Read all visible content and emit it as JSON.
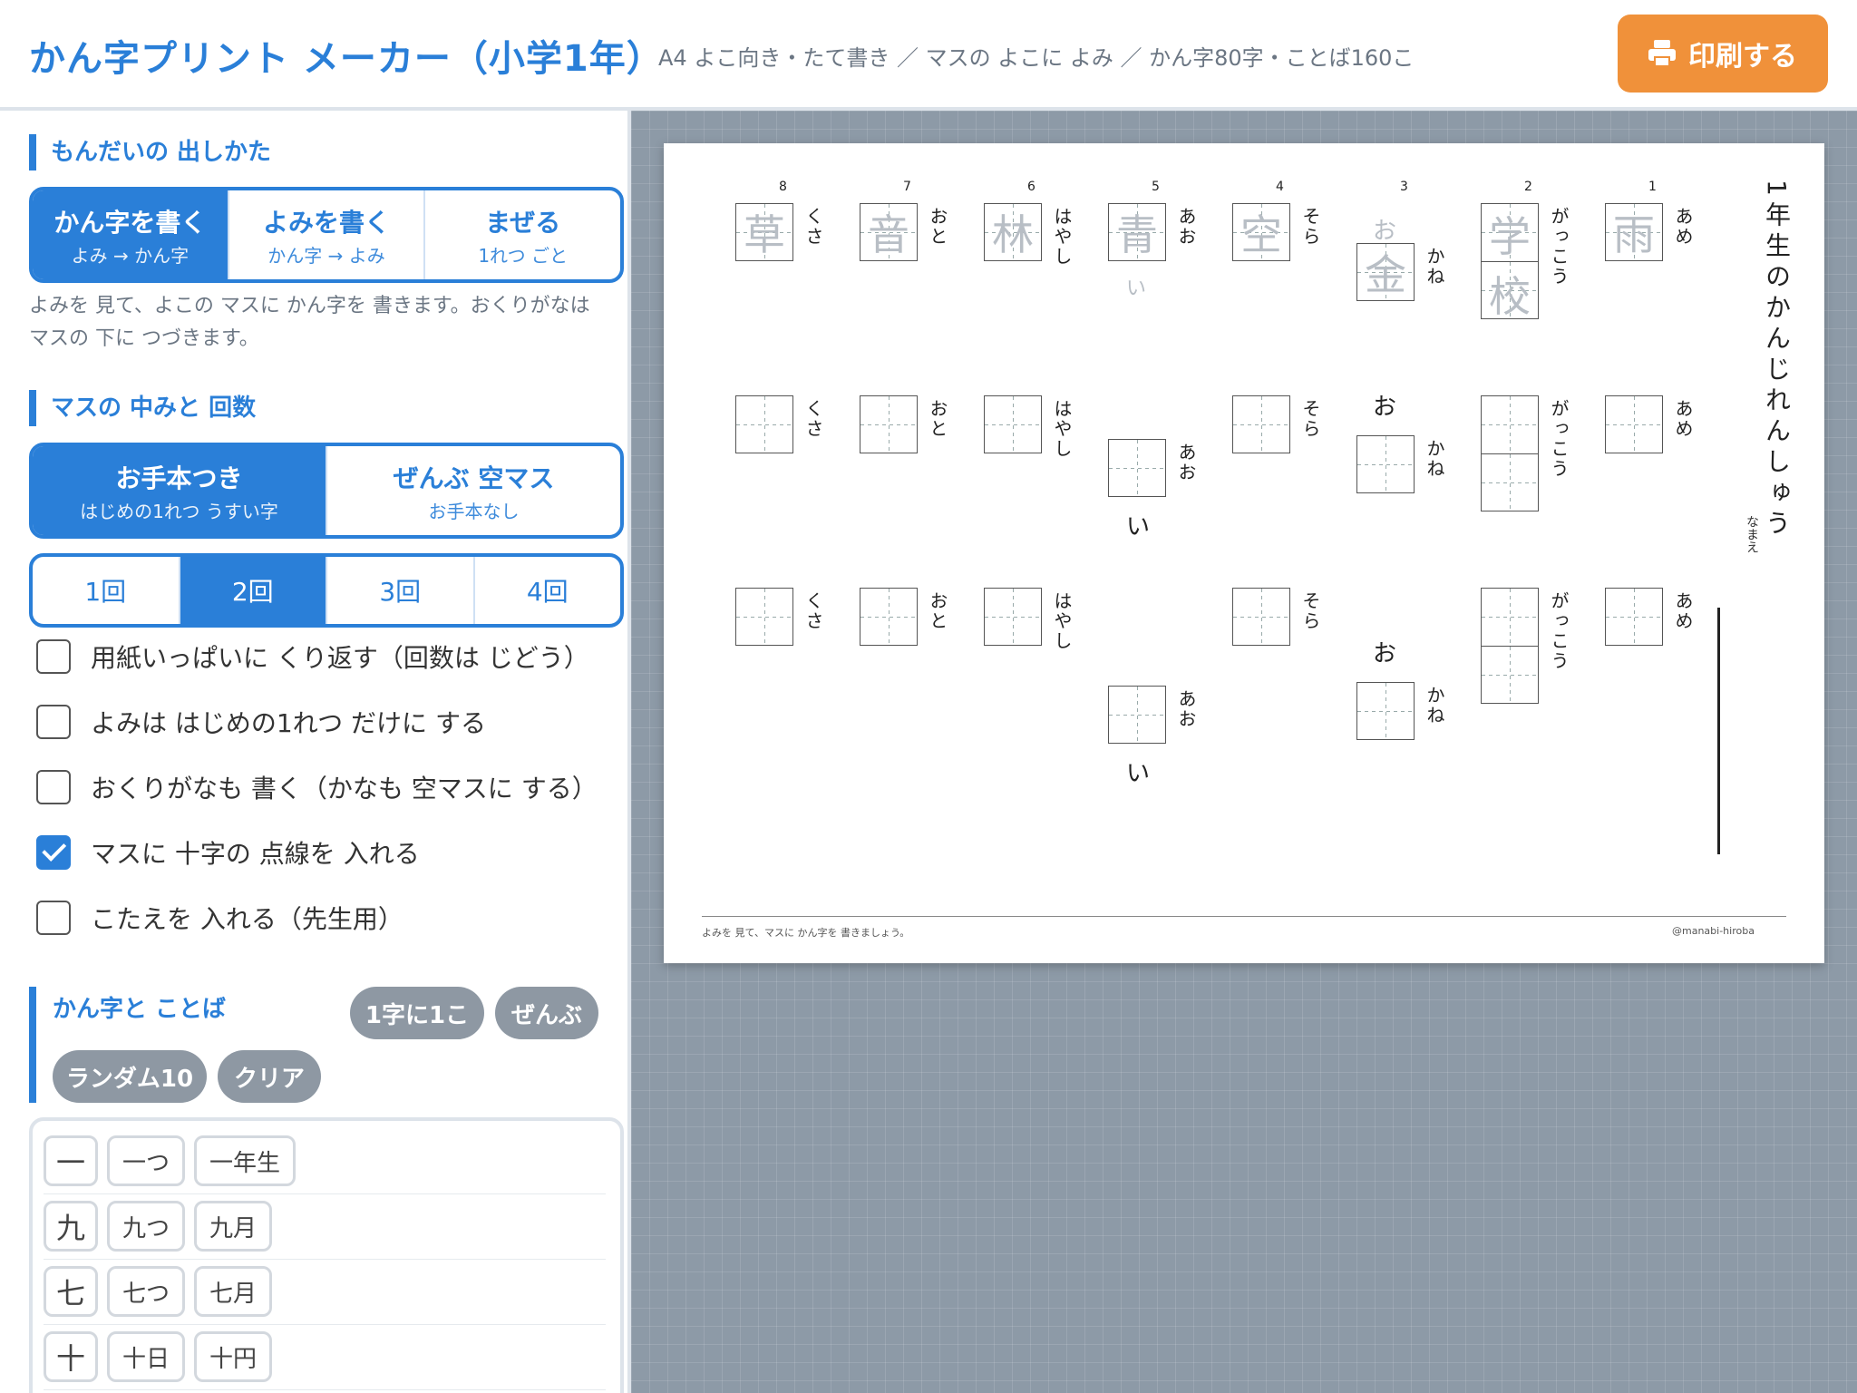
{
  "header": {
    "title": "かん字プリント メーカー（小学1年）",
    "subtitle": "A4 よこ向き・たて書き ／ マスの よこに よみ ／ かん字80字・ことば160こ",
    "print_label": "印刷する"
  },
  "sidebar": {
    "mode_heading": "もんだいの 出しかた",
    "mode_options": [
      {
        "label": "かん字を書く",
        "sub": "よみ → かん字"
      },
      {
        "label": "よみを書く",
        "sub": "かん字 → よみ"
      },
      {
        "label": "まぜる",
        "sub": "1れつ ごと"
      }
    ],
    "mode_desc": "よみを 見て、よこの マスに かん字を 書きます。おくりがなは マスの 下に つづきます。",
    "box_heading": "マスの 中みと 回数",
    "box_options": [
      {
        "label": "お手本つき",
        "sub": "はじめの1れつ うすい字"
      },
      {
        "label": "ぜんぶ 空マス",
        "sub": "お手本なし"
      }
    ],
    "count_options": [
      "1回",
      "2回",
      "3回",
      "4回"
    ],
    "checkboxes": [
      {
        "label": "用紙いっぱいに くり返す（回数は じどう）",
        "checked": false
      },
      {
        "label": "よみは はじめの1れつ だけに する",
        "checked": false
      },
      {
        "label": "おくりがなも 書く（かなも 空マスに する）",
        "checked": false
      },
      {
        "label": "マスに 十字の 点線を 入れる",
        "checked": true
      },
      {
        "label": "こたえを 入れる（先生用）",
        "checked": false
      }
    ],
    "kanji_heading": "かん字と ことば",
    "kanji_buttons": [
      "1字に1こ",
      "ぜんぶ",
      "ランダム10",
      "クリア"
    ],
    "kanji_rows": [
      {
        "kanji": "一",
        "words": [
          "一つ",
          "一年生"
        ]
      },
      {
        "kanji": "九",
        "words": [
          "九つ",
          "九月"
        ]
      },
      {
        "kanji": "七",
        "words": [
          "七つ",
          "七月"
        ]
      },
      {
        "kanji": "十",
        "words": [
          "十日",
          "十円"
        ]
      }
    ]
  },
  "sheet": {
    "title": "1年生のかんじれんしゅう",
    "name_label": "なまえ",
    "footer_left": "よみを 見て、マスに かん字を 書きましょう。",
    "footer_right": "@manabi-hiroba",
    "columns": [
      {
        "num": "1",
        "reading": "あめ",
        "kanji": [
          "雨"
        ],
        "okuri_before": "",
        "okuri_after": ""
      },
      {
        "num": "2",
        "reading": "がっこう",
        "kanji": [
          "学",
          "校"
        ],
        "okuri_before": "",
        "okuri_after": ""
      },
      {
        "num": "3",
        "reading": "かね",
        "kanji": [
          "金"
        ],
        "okuri_before": "お",
        "okuri_after": ""
      },
      {
        "num": "4",
        "reading": "そら",
        "kanji": [
          "空"
        ],
        "okuri_before": "",
        "okuri_after": ""
      },
      {
        "num": "5",
        "reading": "あお",
        "kanji": [
          "青"
        ],
        "okuri_before": "",
        "okuri_after": "い"
      },
      {
        "num": "6",
        "reading": "はやし",
        "kanji": [
          "林"
        ],
        "okuri_before": "",
        "okuri_after": ""
      },
      {
        "num": "7",
        "reading": "おと",
        "kanji": [
          "音"
        ],
        "okuri_before": "",
        "okuri_after": ""
      },
      {
        "num": "8",
        "reading": "くさ",
        "kanji": [
          "草"
        ],
        "okuri_before": "",
        "okuri_after": ""
      }
    ]
  },
  "colors": {
    "accent": "#2a7fd8",
    "print": "#f0913a",
    "chip": "#8e98a3"
  }
}
